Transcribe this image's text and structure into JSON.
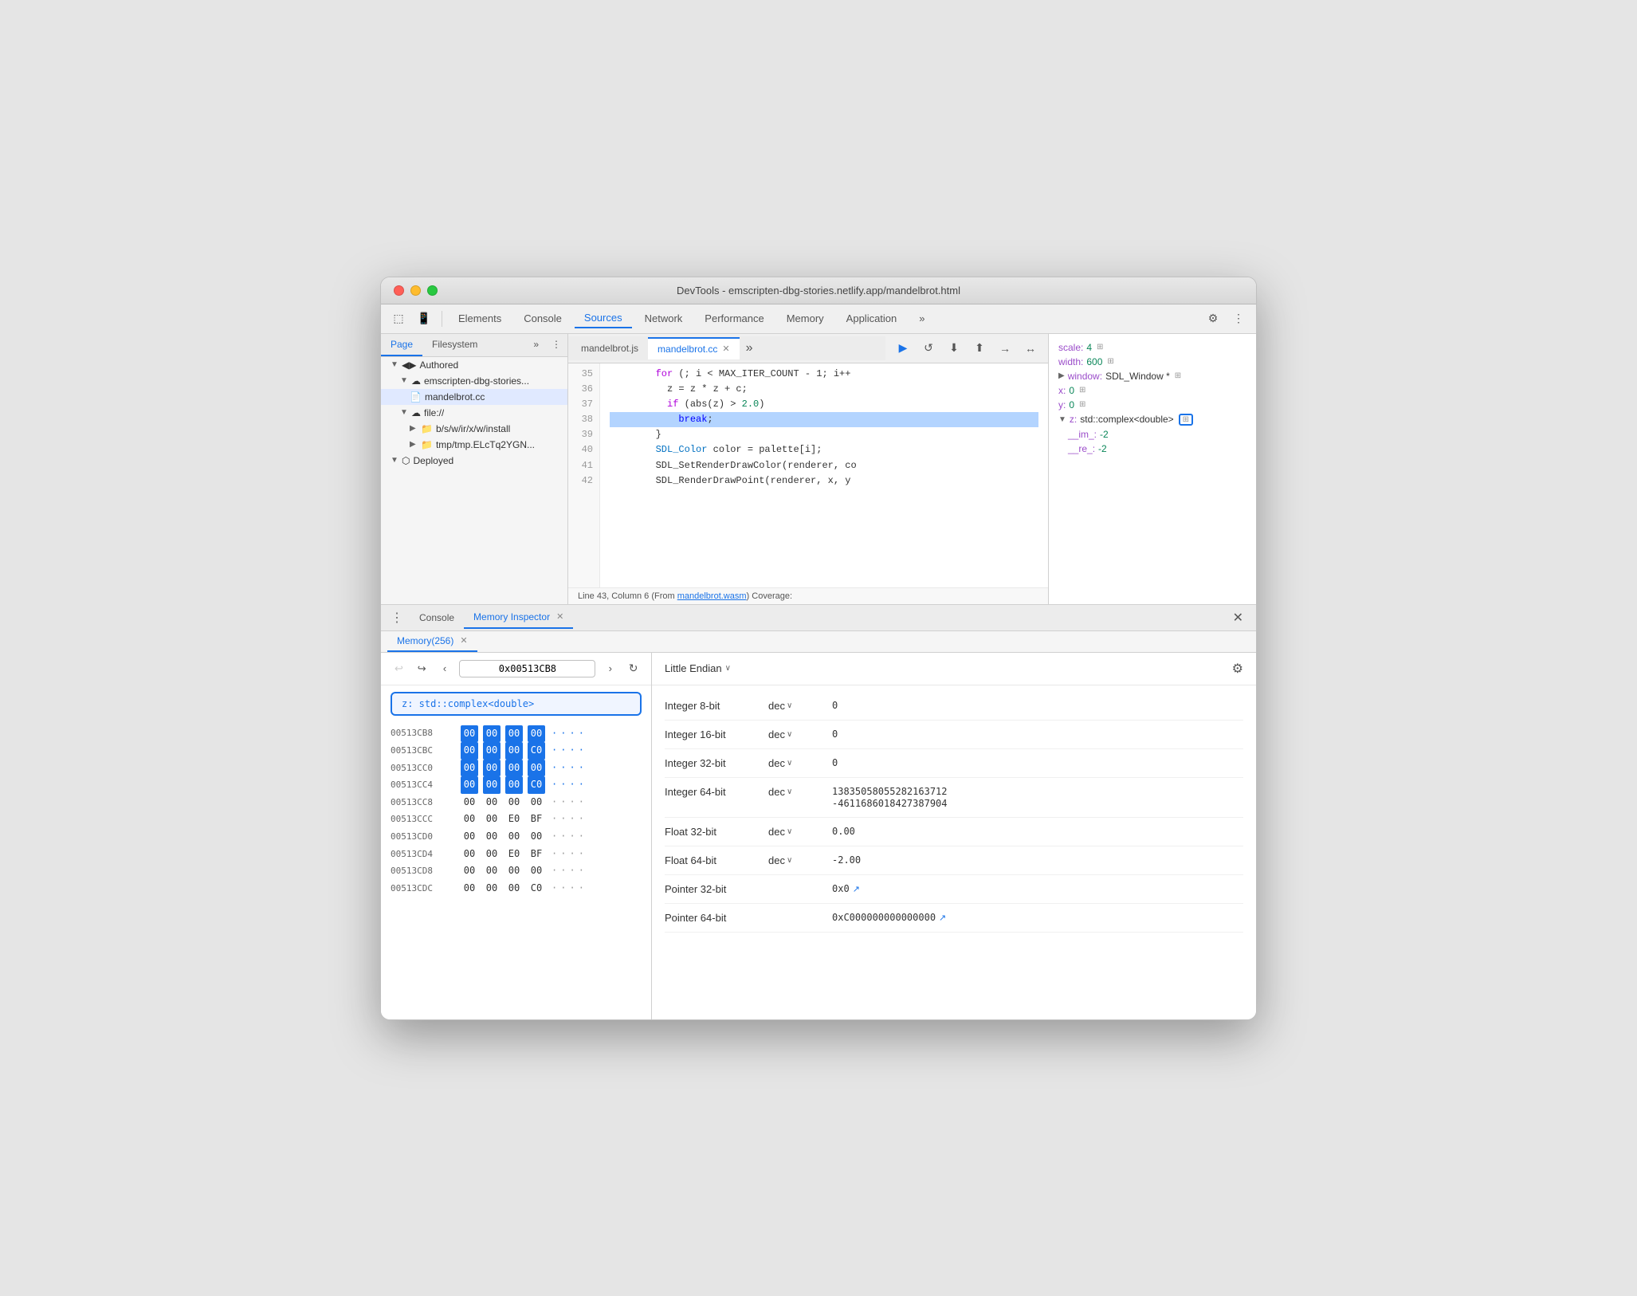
{
  "window": {
    "title": "DevTools - emscripten-dbg-stories.netlify.app/mandelbrot.html"
  },
  "toolbar": {
    "tabs": [
      "Elements",
      "Console",
      "Sources",
      "Network",
      "Performance",
      "Memory",
      "Application"
    ],
    "active_tab": "Sources",
    "more_label": "»"
  },
  "sidebar": {
    "tabs": [
      "Page",
      "Filesystem"
    ],
    "active_tab": "Page",
    "more_label": "»",
    "tree": [
      {
        "label": "◀▶ Authored",
        "indent": 0,
        "type": "section"
      },
      {
        "label": "emscripten-dbg-stories...",
        "indent": 1,
        "type": "cloud"
      },
      {
        "label": "mandelbrot.cc",
        "indent": 2,
        "type": "file",
        "selected": true
      },
      {
        "label": "▼ file://",
        "indent": 1,
        "type": "cloud"
      },
      {
        "label": "b/s/w/ir/x/w/install",
        "indent": 2,
        "type": "folder"
      },
      {
        "label": "tmp/tmp.ELcTq2YGN...",
        "indent": 2,
        "type": "folder"
      },
      {
        "label": "▼ Deployed",
        "indent": 0,
        "type": "section"
      }
    ]
  },
  "code_tabs": {
    "tabs": [
      {
        "label": "mandelbrot.js",
        "active": false,
        "closeable": false
      },
      {
        "label": "mandelbrot.cc",
        "active": true,
        "closeable": true
      }
    ],
    "more_label": "»"
  },
  "code": {
    "lines": [
      {
        "num": 35,
        "text": "        for (; i < MAX_ITER_COUNT - 1; i++",
        "highlighted": false
      },
      {
        "num": 36,
        "text": "          z = z * z + c;",
        "highlighted": false
      },
      {
        "num": 37,
        "text": "          if (abs(z) > 2.0)",
        "highlighted": false
      },
      {
        "num": 38,
        "text": "            break;",
        "highlighted": true
      },
      {
        "num": 39,
        "text": "        }",
        "highlighted": false
      },
      {
        "num": 40,
        "text": "        SDL_Color color = palette[i];",
        "highlighted": false
      },
      {
        "num": 41,
        "text": "        SDL_SetRenderDrawColor(renderer, co",
        "highlighted": false
      },
      {
        "num": 42,
        "text": "        SDL_RenderDrawPoint(renderer, x, y",
        "highlighted": false
      }
    ],
    "footer": "Line 43, Column 6 (From mandelbrot.wasm) Coverage:"
  },
  "debugger": {
    "buttons": [
      "▶",
      "↺",
      "⬇",
      "⬆",
      "→•",
      "↔"
    ]
  },
  "scope": {
    "items": [
      {
        "key": "scale:",
        "val": "4",
        "type": "num",
        "icon": "⊞"
      },
      {
        "key": "width:",
        "val": "600",
        "type": "num",
        "icon": "⊞"
      },
      {
        "key": "window:",
        "val": "SDL_Window *",
        "type": "obj",
        "icon": "⊞",
        "expandable": true
      },
      {
        "key": "x:",
        "val": "0",
        "type": "num",
        "icon": "⊞"
      },
      {
        "key": "y:",
        "val": "0",
        "type": "num",
        "icon": "⊞"
      },
      {
        "key": "z:",
        "val": "std::complex<double>",
        "type": "obj",
        "icon": "⊞",
        "expandable": true,
        "highlighted": true
      },
      {
        "key": "__im_:",
        "val": "-2",
        "type": "num",
        "indent": true
      },
      {
        "key": "__re_:",
        "val": "-2",
        "type": "num",
        "indent": true
      }
    ]
  },
  "bottom_tabs": {
    "tabs": [
      {
        "label": "Console",
        "active": false,
        "closeable": false
      },
      {
        "label": "Memory Inspector",
        "active": true,
        "closeable": true
      }
    ]
  },
  "memory_tab": {
    "label": "Memory(256)",
    "closeable": true
  },
  "memory_nav": {
    "address": "0x00513CB8",
    "var_label": "z: std::complex<double>"
  },
  "hex_rows": [
    {
      "addr": "00513CB8",
      "bytes": [
        "00",
        "00",
        "00",
        "00"
      ],
      "highlighted": [
        true,
        true,
        true,
        true
      ],
      "ascii": [
        "·",
        "·",
        "·",
        "·"
      ]
    },
    {
      "addr": "00513CBC",
      "bytes": [
        "00",
        "00",
        "00",
        "C0"
      ],
      "highlighted": [
        true,
        true,
        true,
        true
      ],
      "ascii": [
        "·",
        "·",
        "·",
        "·"
      ]
    },
    {
      "addr": "00513CC0",
      "bytes": [
        "00",
        "00",
        "00",
        "00"
      ],
      "highlighted": [
        true,
        true,
        true,
        true
      ],
      "ascii": [
        "·",
        "·",
        "·",
        "·"
      ]
    },
    {
      "addr": "00513CC4",
      "bytes": [
        "00",
        "00",
        "00",
        "C0"
      ],
      "highlighted": [
        true,
        true,
        true,
        true
      ],
      "ascii": [
        "·",
        "·",
        "·",
        "·"
      ]
    },
    {
      "addr": "00513CC8",
      "bytes": [
        "00",
        "00",
        "00",
        "00"
      ],
      "highlighted": [
        false,
        false,
        false,
        false
      ],
      "ascii": [
        "·",
        "·",
        "·",
        "·"
      ]
    },
    {
      "addr": "00513CCC",
      "bytes": [
        "00",
        "00",
        "E0",
        "BF"
      ],
      "highlighted": [
        false,
        false,
        false,
        false
      ],
      "ascii": [
        "·",
        "·",
        "·",
        "·"
      ]
    },
    {
      "addr": "00513CD0",
      "bytes": [
        "00",
        "00",
        "00",
        "00"
      ],
      "highlighted": [
        false,
        false,
        false,
        false
      ],
      "ascii": [
        "·",
        "·",
        "·",
        "·"
      ]
    },
    {
      "addr": "00513CD4",
      "bytes": [
        "00",
        "00",
        "E0",
        "BF"
      ],
      "highlighted": [
        false,
        false,
        false,
        false
      ],
      "ascii": [
        "·",
        "·",
        "·",
        "·"
      ]
    },
    {
      "addr": "00513CD8",
      "bytes": [
        "00",
        "00",
        "00",
        "00"
      ],
      "highlighted": [
        false,
        false,
        false,
        false
      ],
      "ascii": [
        "·",
        "·",
        "·",
        "·"
      ]
    },
    {
      "addr": "00513CDC",
      "bytes": [
        "00",
        "00",
        "00",
        "C0"
      ],
      "highlighted": [
        false,
        false,
        false,
        false
      ],
      "ascii": [
        "·",
        "·",
        "·",
        "·"
      ]
    }
  ],
  "interp": {
    "endian": "Little Endian",
    "rows": [
      {
        "type": "Integer 8-bit",
        "fmt": "dec",
        "val": "0"
      },
      {
        "type": "Integer 16-bit",
        "fmt": "dec",
        "val": "0"
      },
      {
        "type": "Integer 32-bit",
        "fmt": "dec",
        "val": "0"
      },
      {
        "type": "Integer 64-bit",
        "fmt": "dec",
        "val": "13835058055282163712",
        "val2": "-4611686018427387904"
      },
      {
        "type": "Float 32-bit",
        "fmt": "dec",
        "val": "0.00"
      },
      {
        "type": "Float 64-bit",
        "fmt": "dec",
        "val": "-2.00"
      },
      {
        "type": "Pointer 32-bit",
        "fmt": "",
        "val": "0x0",
        "link": true
      },
      {
        "type": "Pointer 64-bit",
        "fmt": "",
        "val": "0xC000000000000000",
        "link": true
      }
    ]
  }
}
